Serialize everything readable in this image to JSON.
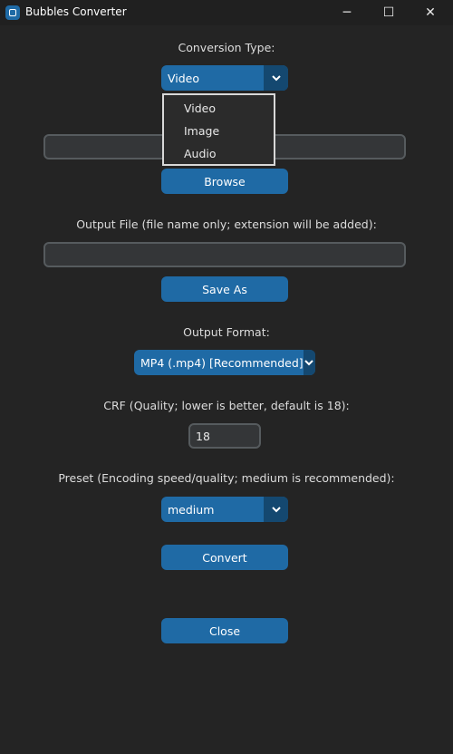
{
  "window": {
    "title": "Bubbles Converter",
    "controls": {
      "minimize": "─",
      "maximize": "☐",
      "close": "✕"
    }
  },
  "conversion": {
    "label": "Conversion Type:",
    "selected": "Video",
    "options": [
      "Video",
      "Image",
      "Audio"
    ]
  },
  "input": {
    "value": "",
    "browse_label": "Browse"
  },
  "output": {
    "label": "Output File (file name only; extension will be added):",
    "value": "",
    "save_as_label": "Save As"
  },
  "format": {
    "label": "Output Format:",
    "selected": "MP4 (.mp4) [Recommended]"
  },
  "crf": {
    "label": "CRF (Quality; lower is better, default is 18):",
    "value": "18"
  },
  "preset": {
    "label": "Preset (Encoding speed/quality; medium is recommended):",
    "selected": "medium"
  },
  "actions": {
    "convert_label": "Convert",
    "close_label": "Close"
  },
  "colors": {
    "accent": "#1f6aa5",
    "accent_dark": "#144870",
    "background": "#242424"
  }
}
